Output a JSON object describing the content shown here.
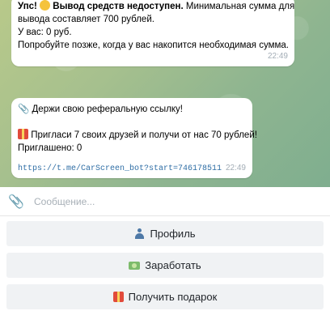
{
  "messages": [
    {
      "lines": [
        {
          "bold": "Упс! ",
          "emoji": "smile-emoji",
          "bold2": " Вывод средств недоступен.",
          "text": " Минимальная сумма для"
        },
        {
          "text": "вывода составляет 700 рублей."
        },
        {
          "text": "У вас: 0 руб."
        },
        {
          "text": "Попробуйте позже, когда у вас накопится необходимая сумма."
        }
      ],
      "time": "22:49"
    },
    {
      "lines": [
        {
          "emoji": "paperclip-emoji",
          "text": " Держи свою реферальную ссылку!"
        },
        {
          "text": ""
        },
        {
          "emoji": "gift-emoji",
          "text": " Пригласи 7 своих друзей и получи от нас 70 рублей!"
        },
        {
          "text": "Приглашено: 0"
        }
      ],
      "link": "https://t.me/CarScreen_bot?start=746178511",
      "time": "22:49"
    }
  ],
  "composer": {
    "placeholder": "Сообщение..."
  },
  "keyboard": [
    {
      "label": "Профиль",
      "icon": "person-icon"
    },
    {
      "label": "Заработать",
      "icon": "money-icon"
    },
    {
      "label": "Получить подарок",
      "icon": "gift-icon"
    }
  ],
  "colors": {
    "link": "#2f6ea5",
    "timestamp": "#a3adb6",
    "button_bg": "#f0f2f4"
  }
}
